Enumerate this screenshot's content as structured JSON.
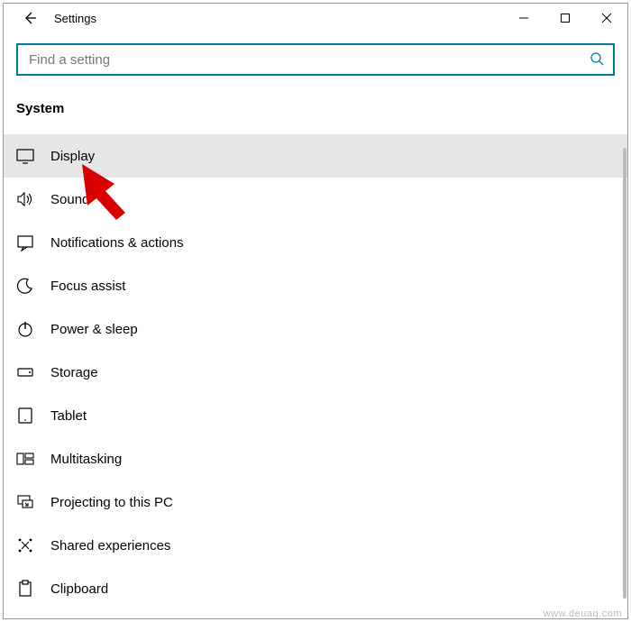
{
  "window": {
    "title": "Settings"
  },
  "search": {
    "placeholder": "Find a setting"
  },
  "section": {
    "label": "System"
  },
  "menu": {
    "items": [
      {
        "icon": "display-icon",
        "label": "Display",
        "selected": true
      },
      {
        "icon": "sound-icon",
        "label": "Sound",
        "selected": false
      },
      {
        "icon": "notifications-icon",
        "label": "Notifications & actions",
        "selected": false
      },
      {
        "icon": "focus-assist-icon",
        "label": "Focus assist",
        "selected": false
      },
      {
        "icon": "power-icon",
        "label": "Power & sleep",
        "selected": false
      },
      {
        "icon": "storage-icon",
        "label": "Storage",
        "selected": false
      },
      {
        "icon": "tablet-icon",
        "label": "Tablet",
        "selected": false
      },
      {
        "icon": "multitasking-icon",
        "label": "Multitasking",
        "selected": false
      },
      {
        "icon": "projecting-icon",
        "label": "Projecting to this PC",
        "selected": false
      },
      {
        "icon": "shared-experiences-icon",
        "label": "Shared experiences",
        "selected": false
      },
      {
        "icon": "clipboard-icon",
        "label": "Clipboard",
        "selected": false
      }
    ]
  },
  "watermark": "www.deuaq.com"
}
